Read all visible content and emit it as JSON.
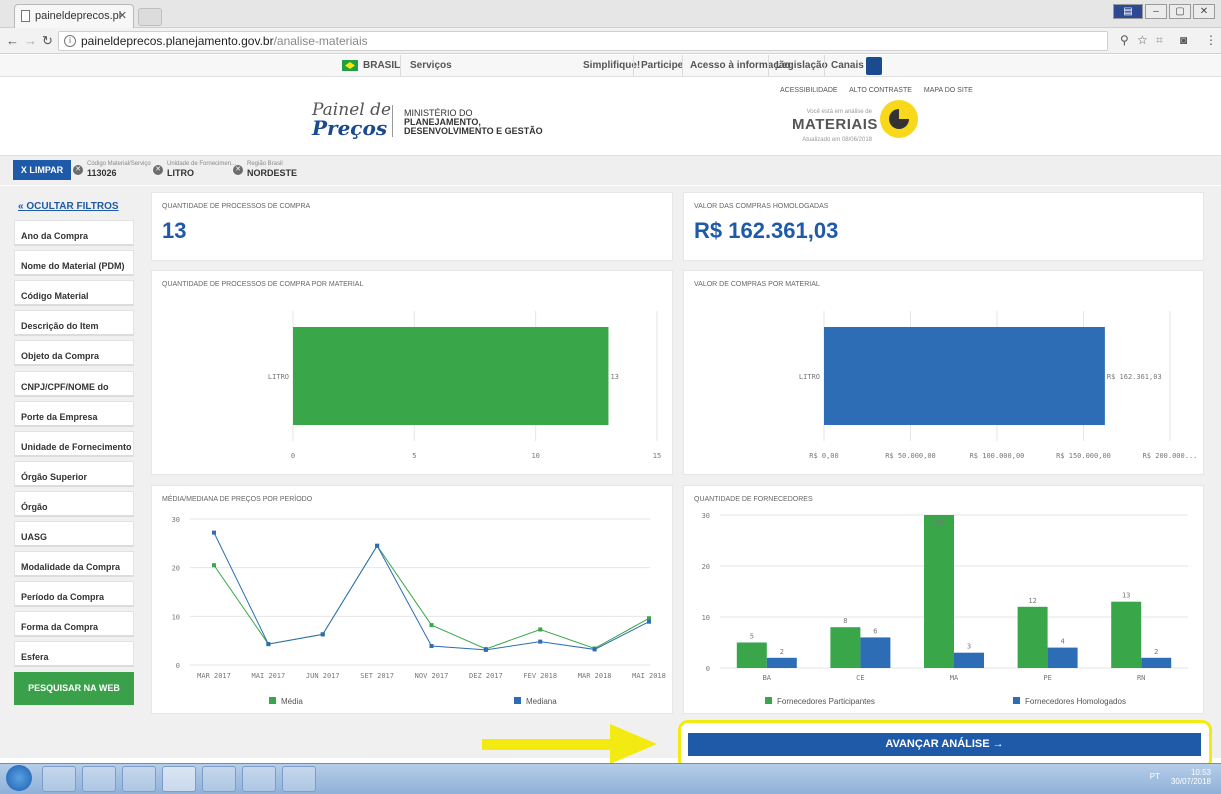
{
  "browser": {
    "tab_title": "paineldeprecos.planejam",
    "url_host": "paineldeprecos.planejamento.gov.br",
    "url_path": "/analise-materiais"
  },
  "govbar": {
    "country": "BRASIL",
    "services": "Serviços",
    "links": [
      "Simplifique!",
      "Participe",
      "Acesso à informação",
      "Legislação",
      "Canais"
    ]
  },
  "header": {
    "logo_line1": "Painel de",
    "logo_line2": "Preços",
    "ministry_line1": "MINISTÉRIO DO",
    "ministry_line2": "PLANEJAMENTO,",
    "ministry_line3": "DESENVOLVIMENTO E GESTÃO",
    "top_links": [
      "ACESSIBILIDADE",
      "ALTO CONTRASTE",
      "MAPA DO SITE"
    ],
    "analysis_context": "Você está em análise de",
    "analysis_title": "MATERIAIS",
    "updated": "Atualizado em 08/06/2018"
  },
  "filter_strip": {
    "clear_label": "X LIMPAR",
    "chips": [
      {
        "label": "Código Material/Serviço",
        "value": "113026"
      },
      {
        "label": "Unidade de Fornecimen...",
        "value": "LITRO"
      },
      {
        "label": "Região Brasil",
        "value": "NORDESTE"
      }
    ]
  },
  "sidebar": {
    "hide_filters": "OCULTAR FILTROS",
    "filters": [
      "Ano da Compra",
      "Nome do Material (PDM)",
      "Código Material",
      "Descrição do Item",
      "Objeto da Compra",
      "CNPJ/CPF/NOME do Fornecedor",
      "Porte da Empresa",
      "Unidade de Fornecimento",
      "Órgão Superior",
      "Órgão",
      "UASG",
      "Modalidade da Compra",
      "Período da Compra",
      "Forma da Compra",
      "Esfera"
    ],
    "search_web": "PESQUISAR NA WEB"
  },
  "kpis": {
    "processes_title": "QUANTIDADE DE PROCESSOS DE COMPRA",
    "processes_value": "13",
    "value_title": "VALOR DAS COMPRAS HOMOLOGADAS",
    "value_value": "R$ 162.361,03"
  },
  "chart_data": [
    {
      "type": "bar",
      "orientation": "horizontal",
      "title": "QUANTIDADE DE PROCESSOS DE COMPRA POR MATERIAL",
      "categories": [
        "LITRO"
      ],
      "values": [
        13
      ],
      "data_labels": [
        "13"
      ],
      "xlim": [
        0,
        15
      ],
      "x_ticks": [
        "0",
        "5",
        "10",
        "15"
      ],
      "color": "#3aa64a"
    },
    {
      "type": "bar",
      "orientation": "horizontal",
      "title": "VALOR DE COMPRAS POR MATERIAL",
      "categories": [
        "LITRO"
      ],
      "values": [
        162361.03
      ],
      "data_labels": [
        "R$ 162.361,03"
      ],
      "xlim": [
        0,
        200000
      ],
      "x_ticks": [
        "R$ 0,00",
        "R$ 50.000,00",
        "R$ 100.000,00",
        "R$ 150.000,00",
        "R$ 200.000..."
      ],
      "color": "#2c6db5"
    },
    {
      "type": "line",
      "title": "MÉDIA/MEDIANA DE PREÇOS POR PERÍODO",
      "categories": [
        "MAR 2017",
        "MAI 2017",
        "JUN 2017",
        "SET 2017",
        "NOV 2017",
        "DEZ 2017",
        "FEV 2018",
        "MAR 2018",
        "MAI 2018"
      ],
      "series": [
        {
          "name": "Média",
          "values": [
            20.5,
            4.3,
            6.3,
            24.5,
            8.2,
            3.3,
            7.3,
            3.4,
            9.6
          ],
          "color": "#3aa64a"
        },
        {
          "name": "Mediana",
          "values": [
            27.2,
            4.3,
            6.3,
            24.5,
            3.9,
            3.1,
            4.8,
            3.2,
            8.9
          ],
          "color": "#2c6db5"
        }
      ],
      "ylim": [
        0,
        30
      ],
      "y_ticks": [
        "0",
        "10",
        "20",
        "30"
      ],
      "legend": "bottom"
    },
    {
      "type": "bar",
      "title": "QUANTIDADE DE FORNECEDORES",
      "categories": [
        "BA",
        "CE",
        "MA",
        "PE",
        "RN"
      ],
      "series": [
        {
          "name": "Fornecedores Participantes",
          "values": [
            5,
            8,
            30,
            12,
            13
          ],
          "color": "#3aa64a"
        },
        {
          "name": "Fornecedores Homologados",
          "values": [
            2,
            6,
            3,
            4,
            2
          ],
          "color": "#2c6db5"
        }
      ],
      "ylim": [
        0,
        30
      ],
      "y_ticks": [
        "0",
        "10",
        "20",
        "30"
      ],
      "legend": "bottom"
    }
  ],
  "footer": {
    "advance_label": "AVANÇAR ANÁLISE →"
  },
  "taskbar": {
    "lang": "PT",
    "time": "10:53",
    "date": "30/07/2018"
  }
}
